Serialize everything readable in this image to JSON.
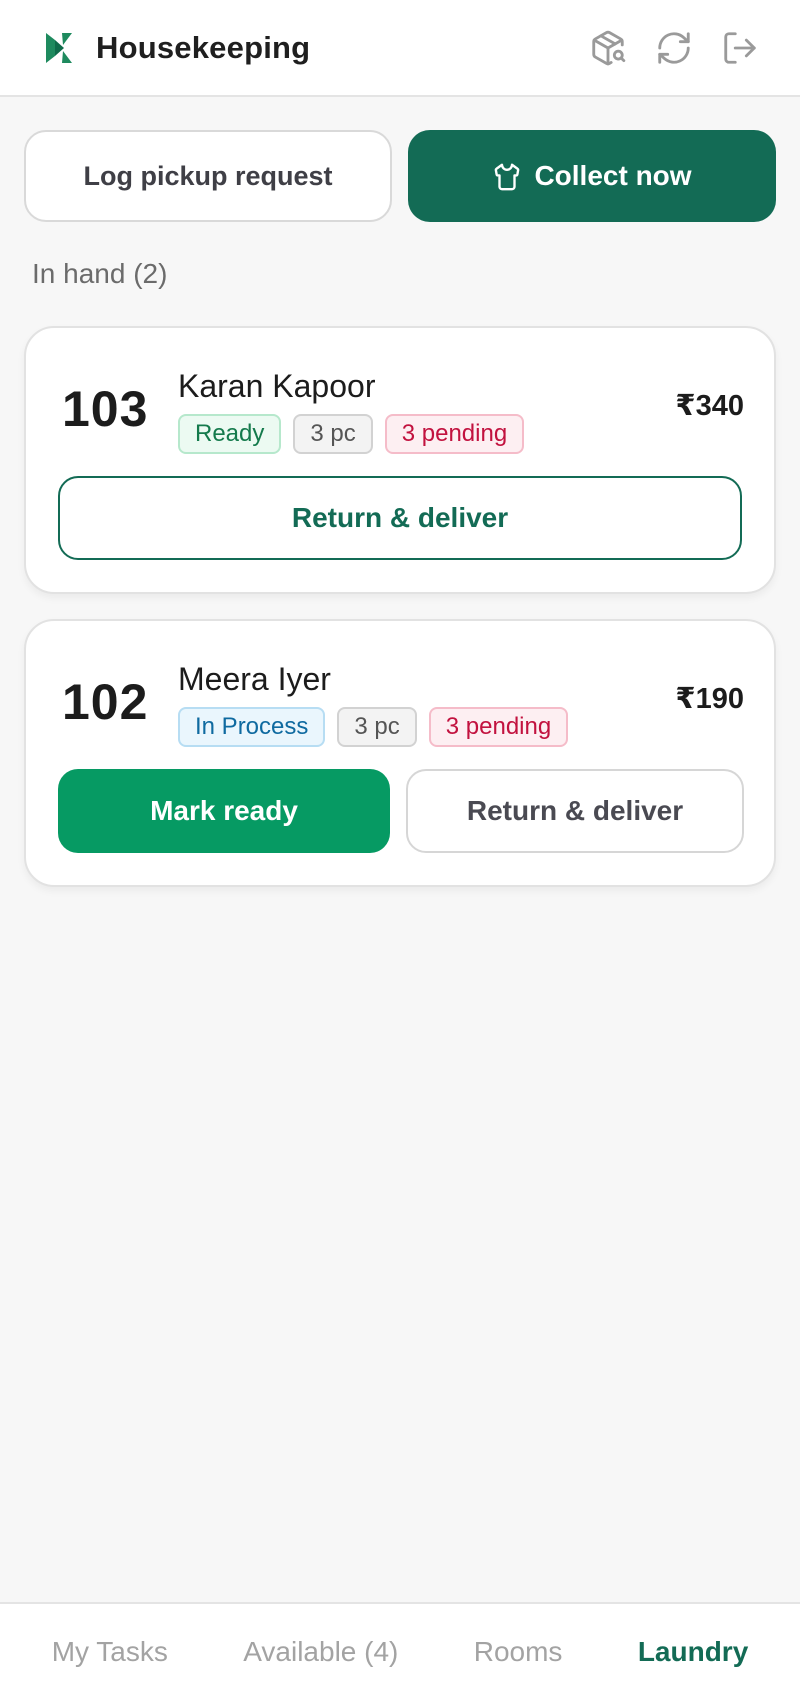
{
  "header": {
    "title": "Housekeeping",
    "icons": [
      "logo-icon",
      "package-search-icon",
      "refresh-icon",
      "logout-icon"
    ]
  },
  "actions": {
    "log_pickup": "Log pickup request",
    "collect_now": "Collect now"
  },
  "section": {
    "label": "In hand (2)"
  },
  "cards": [
    {
      "room": "103",
      "guest": "Karan Kapoor",
      "status": "Ready",
      "pieces": "3 pc",
      "pending": "3 pending",
      "price": "₹340",
      "buttons": {
        "return": "Return & deliver"
      }
    },
    {
      "room": "102",
      "guest": "Meera Iyer",
      "status": "In Process",
      "pieces": "3 pc",
      "pending": "3 pending",
      "price": "₹190",
      "buttons": {
        "mark_ready": "Mark ready",
        "return": "Return & deliver"
      }
    }
  ],
  "nav": {
    "items": [
      {
        "label": "My Tasks"
      },
      {
        "label": "Available (4)"
      },
      {
        "label": "Rooms"
      },
      {
        "label": "Laundry"
      }
    ],
    "active": "Laundry"
  },
  "colors": {
    "brand": "#136b55",
    "accent_green": "#069a63",
    "ready": "#147a4c",
    "in_process": "#0f6aa0",
    "pending": "#c2123f"
  }
}
